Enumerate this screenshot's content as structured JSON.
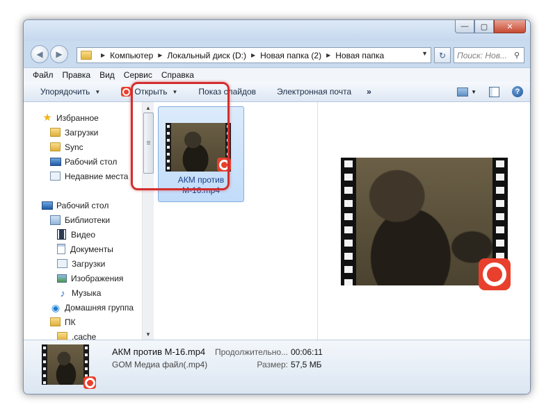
{
  "window": {
    "controls": {
      "minimize": "—",
      "maximize": "▢",
      "close": "✕"
    }
  },
  "address": {
    "crumbs": [
      "Компьютер",
      "Локальный диск (D:)",
      "Новая папка (2)",
      "Новая папка"
    ],
    "search_placeholder": "Поиск: Нов..."
  },
  "menu": {
    "items": [
      "Файл",
      "Правка",
      "Вид",
      "Сервис",
      "Справка"
    ]
  },
  "toolbar": {
    "organize": "Упорядочить",
    "open": "Открыть",
    "slideshow": "Показ слайдов",
    "email": "Электронная почта",
    "more": "»"
  },
  "nav": {
    "favorites": "Избранное",
    "downloads": "Загрузки",
    "sync": "Sync",
    "desktop_fav": "Рабочий стол",
    "recent": "Недавние места",
    "desktop": "Рабочий стол",
    "libraries": "Библиотеки",
    "video": "Видео",
    "documents": "Документы",
    "lib_downloads": "Загрузки",
    "images": "Изображения",
    "music": "Музыка",
    "homegroup": "Домашняя группа",
    "pc": "ПК",
    "cache": ".cache"
  },
  "file": {
    "name_line1": "АКМ против",
    "name_line2": "М-16.mp4"
  },
  "details": {
    "name": "АКМ против М-16.mp4",
    "type": "GOM Медиа файл(.mp4)",
    "duration_label": "Продолжительно...",
    "duration_value": "00:06:11",
    "size_label": "Размер:",
    "size_value": "57,5 МБ"
  }
}
